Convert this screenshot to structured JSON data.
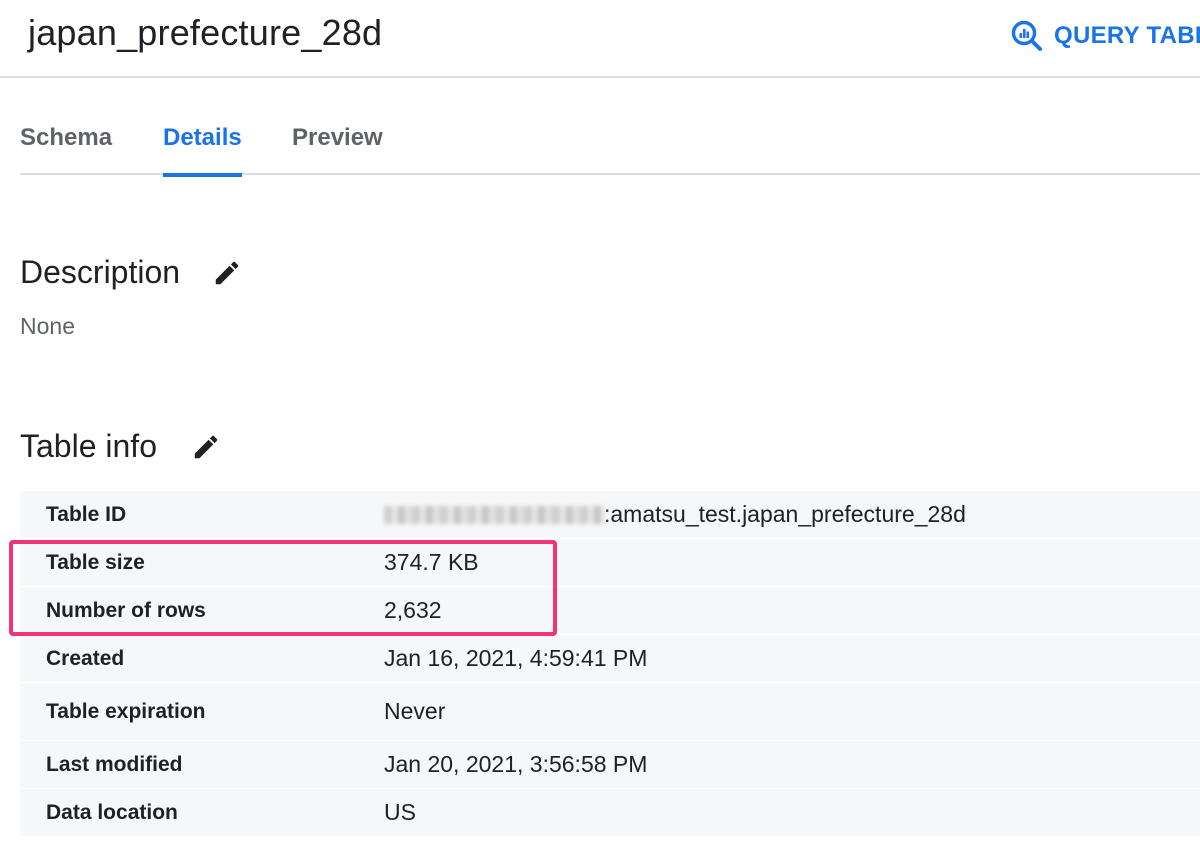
{
  "header": {
    "title": "japan_prefecture_28d",
    "query_button_label": "QUERY TABLE"
  },
  "tabs": [
    {
      "label": "Schema",
      "active": false
    },
    {
      "label": "Details",
      "active": true
    },
    {
      "label": "Preview",
      "active": false
    }
  ],
  "description": {
    "title": "Description",
    "value": "None"
  },
  "table_info": {
    "title": "Table info",
    "rows": [
      {
        "label": "Table ID",
        "value": ":amatsu_test.japan_prefecture_28d"
      },
      {
        "label": "Table size",
        "value": "374.7 KB"
      },
      {
        "label": "Number of rows",
        "value": "2,632"
      },
      {
        "label": "Created",
        "value": "Jan 16, 2021, 4:59:41 PM"
      },
      {
        "label": "Table expiration",
        "value": "Never"
      },
      {
        "label": "Last modified",
        "value": "Jan 20, 2021, 3:56:58 PM"
      },
      {
        "label": "Data location",
        "value": "US"
      }
    ]
  },
  "icons": {
    "query": "query-table-icon",
    "edit": "pencil-icon"
  },
  "colors": {
    "accent": "#1a73e8",
    "highlight": "#f0337a",
    "row_background": "#f6f7f8"
  }
}
